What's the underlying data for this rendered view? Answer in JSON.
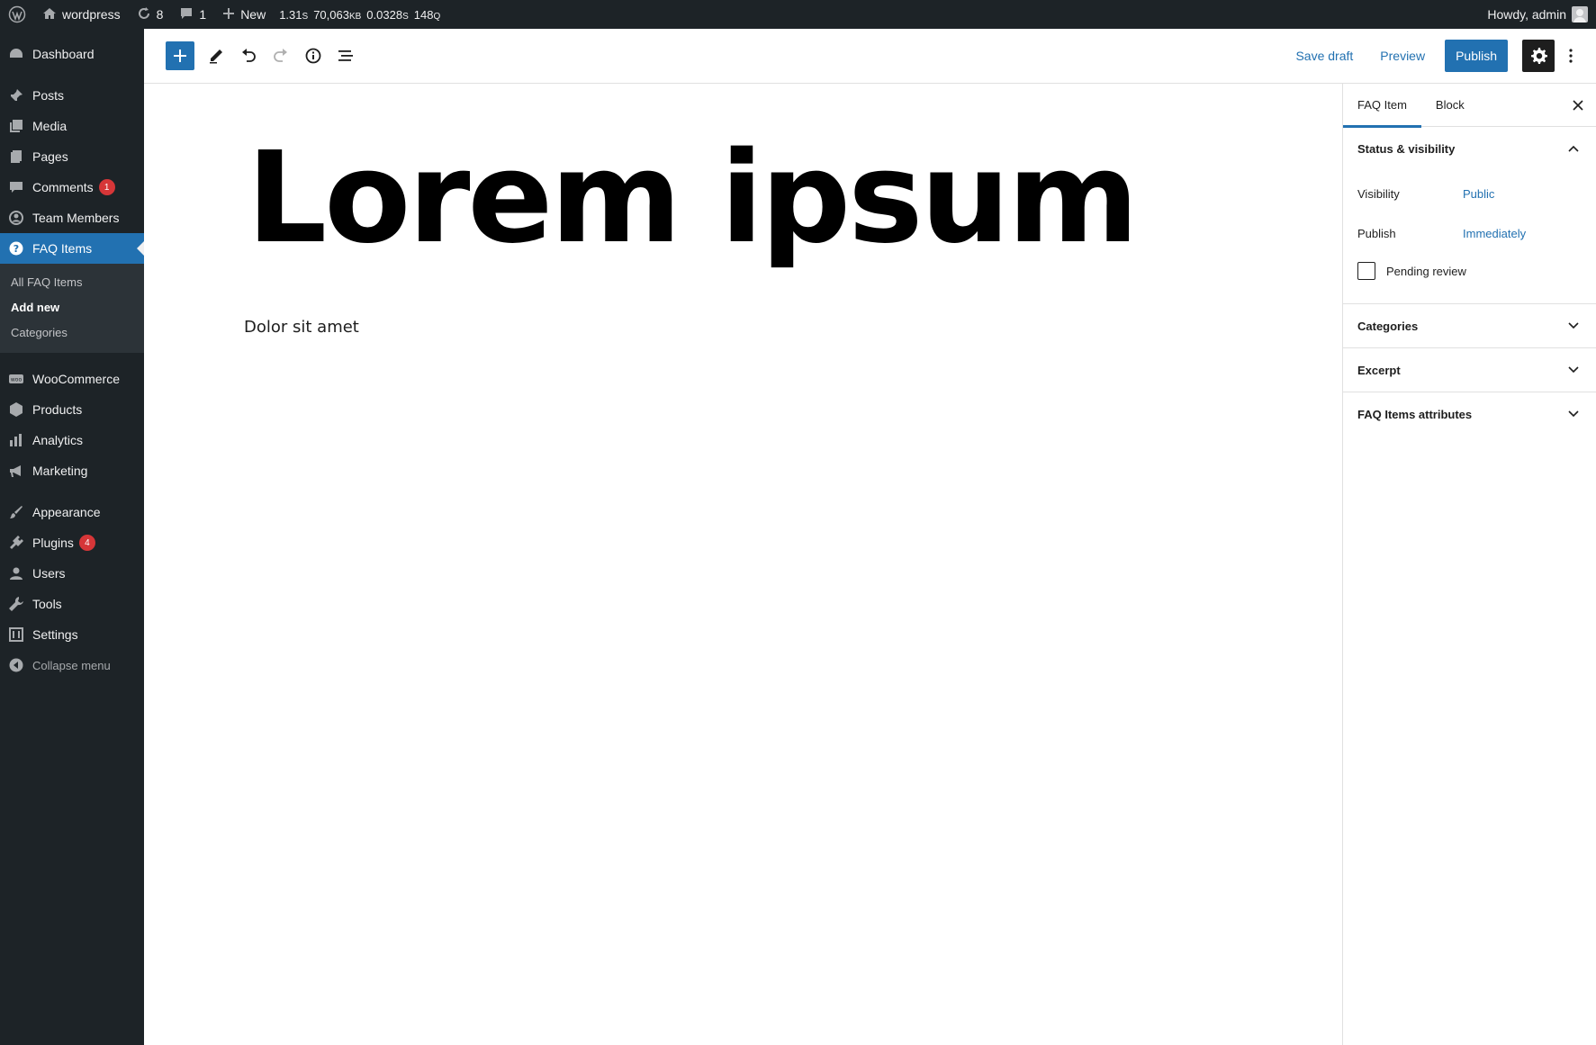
{
  "admin_bar": {
    "site_name": "wordpress",
    "updates_count": "8",
    "comments_count": "1",
    "new_label": "New",
    "stat_time_value": "1.31",
    "stat_time_unit": "s",
    "stat_memory_value": "70,063",
    "stat_memory_unit": "kB",
    "stat_query_time_value": "0.0328",
    "stat_query_time_unit": "s",
    "stat_queries_value": "148",
    "stat_queries_unit": "q",
    "howdy": "Howdy, admin"
  },
  "sidebar": {
    "dashboard": "Dashboard",
    "posts": "Posts",
    "media": "Media",
    "pages": "Pages",
    "comments": "Comments",
    "comments_badge": "1",
    "team_members": "Team Members",
    "faq_items": "FAQ Items",
    "submenu": {
      "all": "All FAQ Items",
      "add_new": "Add new",
      "categories": "Categories"
    },
    "woocommerce": "WooCommerce",
    "products": "Products",
    "analytics": "Analytics",
    "marketing": "Marketing",
    "appearance": "Appearance",
    "plugins": "Plugins",
    "plugins_badge": "4",
    "users": "Users",
    "tools": "Tools",
    "settings": "Settings",
    "collapse": "Collapse menu"
  },
  "toolbar": {
    "save_draft": "Save draft",
    "preview": "Preview",
    "publish": "Publish"
  },
  "post": {
    "title": "Lorem ipsum",
    "paragraph": "Dolor sit amet"
  },
  "settings_panel": {
    "tab_post": "FAQ Item",
    "tab_block": "Block",
    "status_section": "Status & visibility",
    "visibility_label": "Visibility",
    "visibility_value": "Public",
    "publish_label": "Publish",
    "publish_value": "Immediately",
    "pending_review": "Pending review",
    "categories_section": "Categories",
    "excerpt_section": "Excerpt",
    "attributes_section": "FAQ Items attributes"
  },
  "colors": {
    "admin_dark": "#1d2327",
    "accent_blue": "#2271b1",
    "badge_red": "#d63638"
  }
}
